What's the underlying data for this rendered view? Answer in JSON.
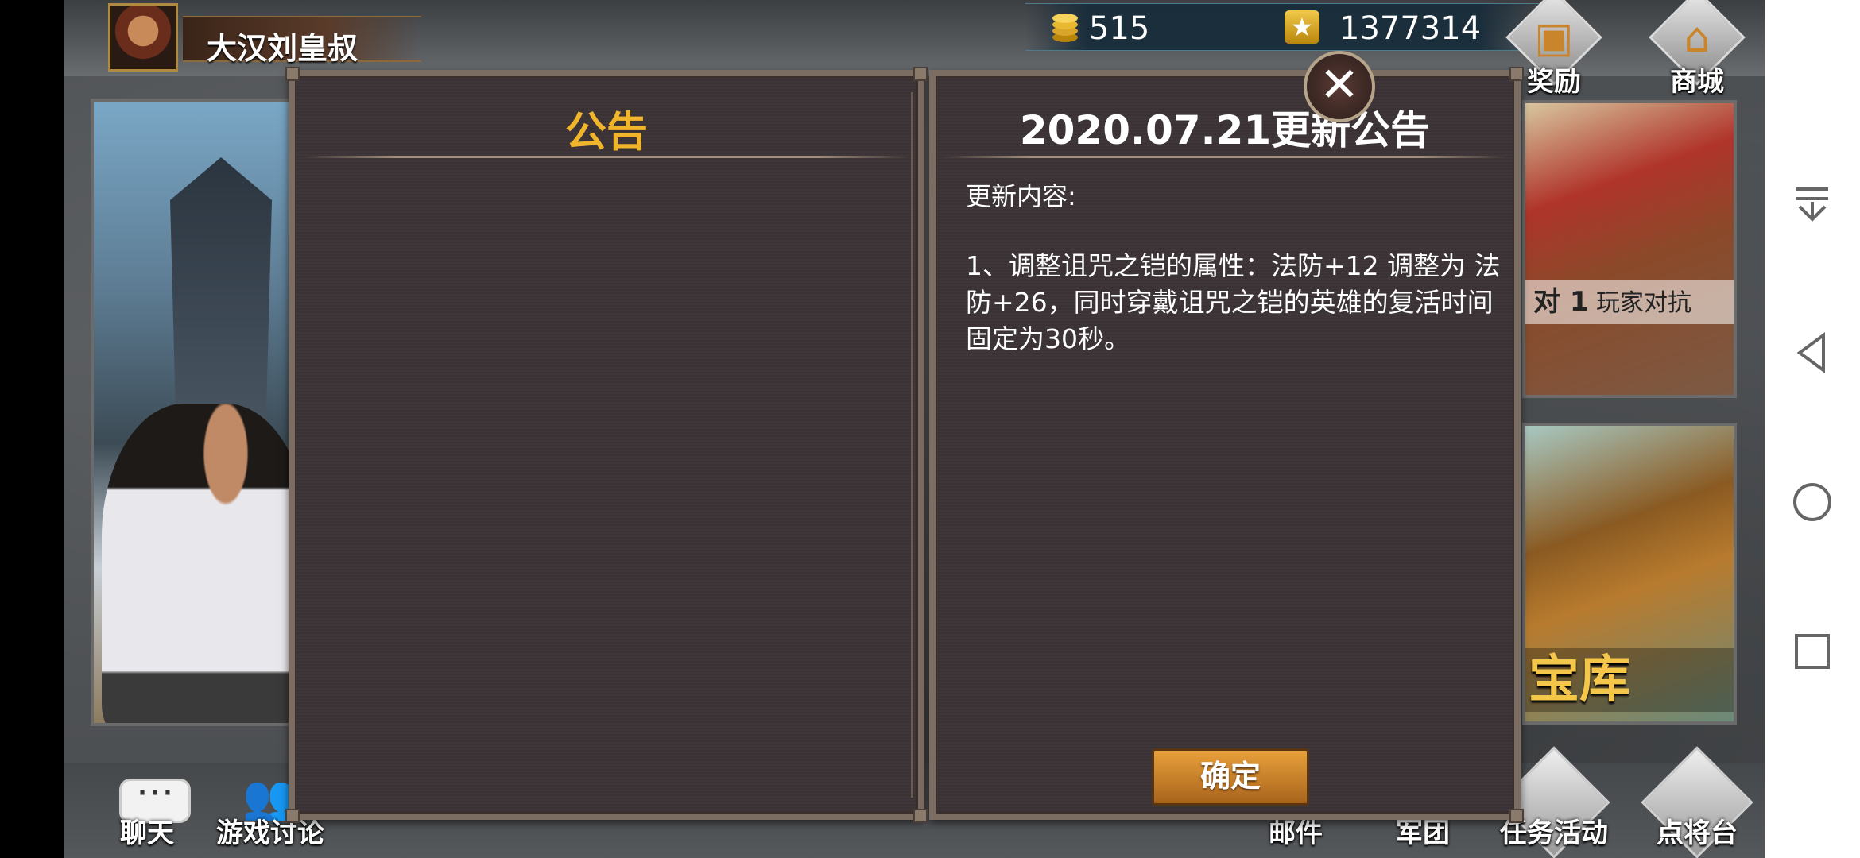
{
  "player": {
    "name": "大汉刘皇叔"
  },
  "resources": {
    "coins": "515",
    "stars": "1377314"
  },
  "top_buttons": {
    "rewards": "奖励",
    "shop": "商城"
  },
  "art_panels": {
    "pvp_caption_prefix": "对 1",
    "pvp_caption": "玩家对抗",
    "treasure_caption": "宝库"
  },
  "dialog": {
    "left_title": "公告",
    "right_title": "2020.07.21更新公告",
    "content_heading": "更新内容:",
    "content_body": "1、调整诅咒之铠的属性：法防+12 调整为 法防+26，同时穿戴诅咒之铠的英雄的复活时间固定为30秒。",
    "confirm_label": "确定",
    "close_glyph": "✕"
  },
  "bottom_buttons": {
    "chat": "聊天",
    "discussion": "游戏讨论",
    "mail": "邮件",
    "legion": "军团",
    "events": "任务活动",
    "general_stage": "点将台"
  },
  "system_nav": {
    "icons": [
      "notification-pull-icon",
      "back-icon",
      "home-icon",
      "recents-icon"
    ]
  }
}
